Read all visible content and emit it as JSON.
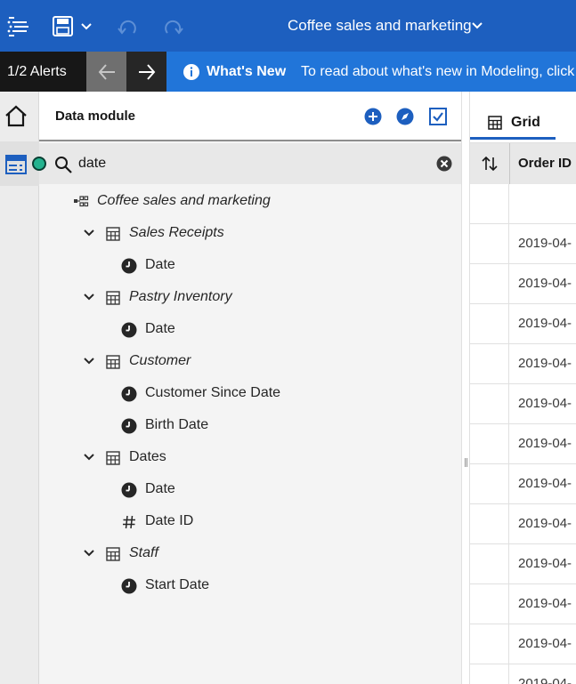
{
  "topbar": {
    "title": "Coffee sales and marketing",
    "icons": [
      "menu-icon",
      "save-icon",
      "chevron-down-icon",
      "undo-icon",
      "redo-icon"
    ]
  },
  "alertbar": {
    "alerts": "1/2 Alerts",
    "whats_new": "What's New",
    "message": "To read about what's new in Modeling, click"
  },
  "panel": {
    "title": "Data module",
    "search_value": "date"
  },
  "tree": {
    "root": "Coffee sales and marketing",
    "tables": [
      {
        "name": "Sales Receipts",
        "italic": true,
        "fields": [
          {
            "name": "Date",
            "icon": "clock-icon"
          }
        ]
      },
      {
        "name": "Pastry Inventory",
        "italic": true,
        "fields": [
          {
            "name": "Date",
            "icon": "clock-icon"
          }
        ]
      },
      {
        "name": "Customer",
        "italic": true,
        "fields": [
          {
            "name": "Customer Since Date",
            "icon": "clock-icon"
          },
          {
            "name": "Birth Date",
            "icon": "clock-icon"
          }
        ]
      },
      {
        "name": "Dates",
        "italic": false,
        "fields": [
          {
            "name": "Date",
            "icon": "clock-icon"
          },
          {
            "name": "Date ID",
            "icon": "hash-icon"
          }
        ]
      },
      {
        "name": "Staff",
        "italic": true,
        "fields": [
          {
            "name": "Start Date",
            "icon": "clock-icon"
          }
        ]
      }
    ]
  },
  "grid": {
    "tab": "Grid",
    "column": "Order ID",
    "rows": [
      "",
      "2019-04-",
      "2019-04-",
      "2019-04-",
      "2019-04-",
      "2019-04-",
      "2019-04-",
      "2019-04-",
      "2019-04-",
      "2019-04-",
      "2019-04-",
      "2019-04-",
      "2019-04-"
    ]
  },
  "colors": {
    "topbar": "#1d5fbf",
    "alertbar": "#2175d9",
    "status": "#24b38f"
  }
}
